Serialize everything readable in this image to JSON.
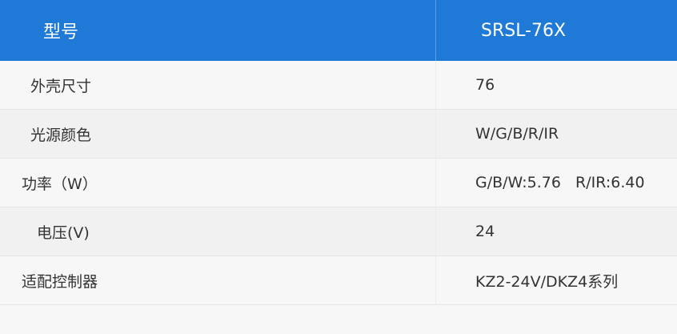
{
  "header": {
    "label": "型号",
    "value": "SRSL-76X"
  },
  "rows": [
    {
      "label": "外壳尺寸",
      "value": "76"
    },
    {
      "label": "光源颜色",
      "value": "W/G/B/R/IR"
    },
    {
      "label": "功率（W）",
      "value": "G/B/W:5.76   R/IR:6.40"
    },
    {
      "label": "电压(V)",
      "value": "24"
    },
    {
      "label": "适配控制器",
      "value": "KZ2-24V/DKZ4系列"
    }
  ],
  "colors": {
    "header_bg": "#1e7ad6",
    "row_odd": "#f7f7f7",
    "row_even": "#f1f1f1",
    "text": "#333333"
  }
}
